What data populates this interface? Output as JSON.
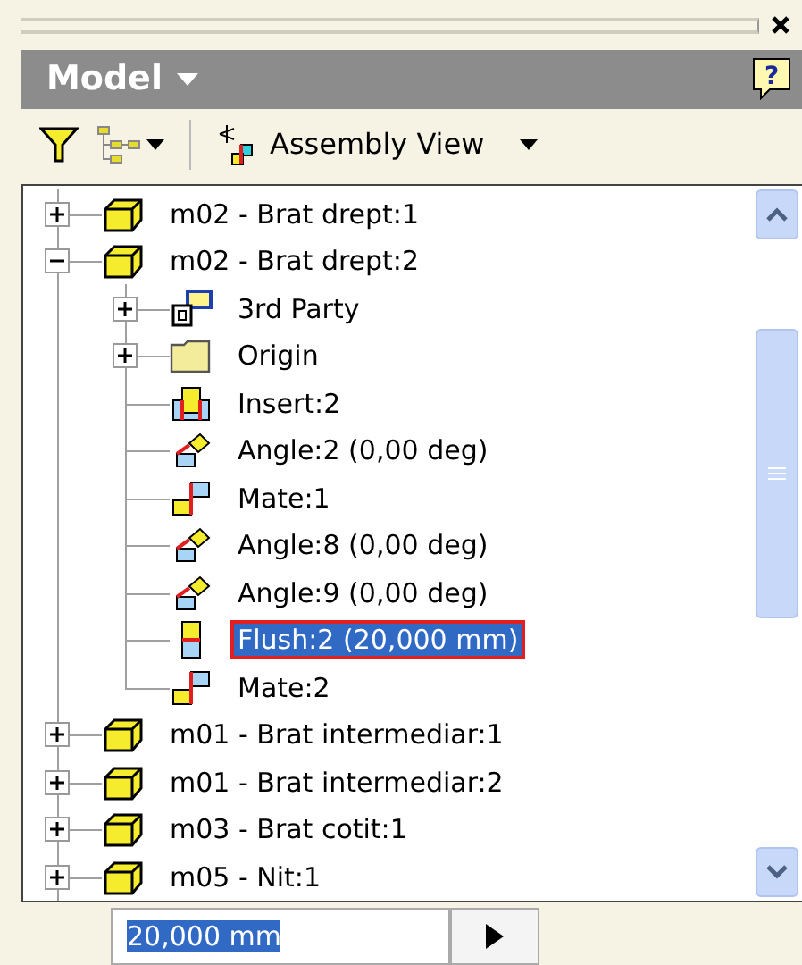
{
  "panel": {
    "title": "Model",
    "help_button": "?"
  },
  "toolbar": {
    "view_label": "Assembly View"
  },
  "tree": [
    {
      "label": "m02 - Brat drept:1",
      "kind": "part",
      "expanded": false,
      "selected": false
    },
    {
      "label": "m02 - Brat drept:2",
      "kind": "part",
      "expanded": true,
      "selected": false,
      "children": [
        {
          "label": "3rd Party",
          "kind": "thirdparty",
          "expanded": false,
          "selected": false
        },
        {
          "label": "Origin",
          "kind": "folder",
          "expanded": false,
          "selected": false
        },
        {
          "label": "Insert:2",
          "kind": "insert",
          "selected": false
        },
        {
          "label": "Angle:2 (0,00 deg)",
          "kind": "angle",
          "selected": false
        },
        {
          "label": "Mate:1",
          "kind": "mate",
          "selected": false
        },
        {
          "label": "Angle:8 (0,00 deg)",
          "kind": "angle",
          "selected": false
        },
        {
          "label": "Angle:9 (0,00 deg)",
          "kind": "angle",
          "selected": false
        },
        {
          "label": "Flush:2 (20,000 mm)",
          "kind": "flush",
          "selected": true
        },
        {
          "label": "Mate:2",
          "kind": "mate",
          "selected": false
        }
      ]
    },
    {
      "label": "m01 - Brat intermediar:1",
      "kind": "part",
      "expanded": false,
      "selected": false
    },
    {
      "label": "m01 - Brat intermediar:2",
      "kind": "part",
      "expanded": false,
      "selected": false
    },
    {
      "label": "m03 - Brat cotit:1",
      "kind": "part",
      "expanded": false,
      "selected": false
    },
    {
      "label": "m05 - Nit:1",
      "kind": "part",
      "expanded": false,
      "selected": false
    }
  ],
  "value_field": {
    "value": "20,000 mm"
  }
}
